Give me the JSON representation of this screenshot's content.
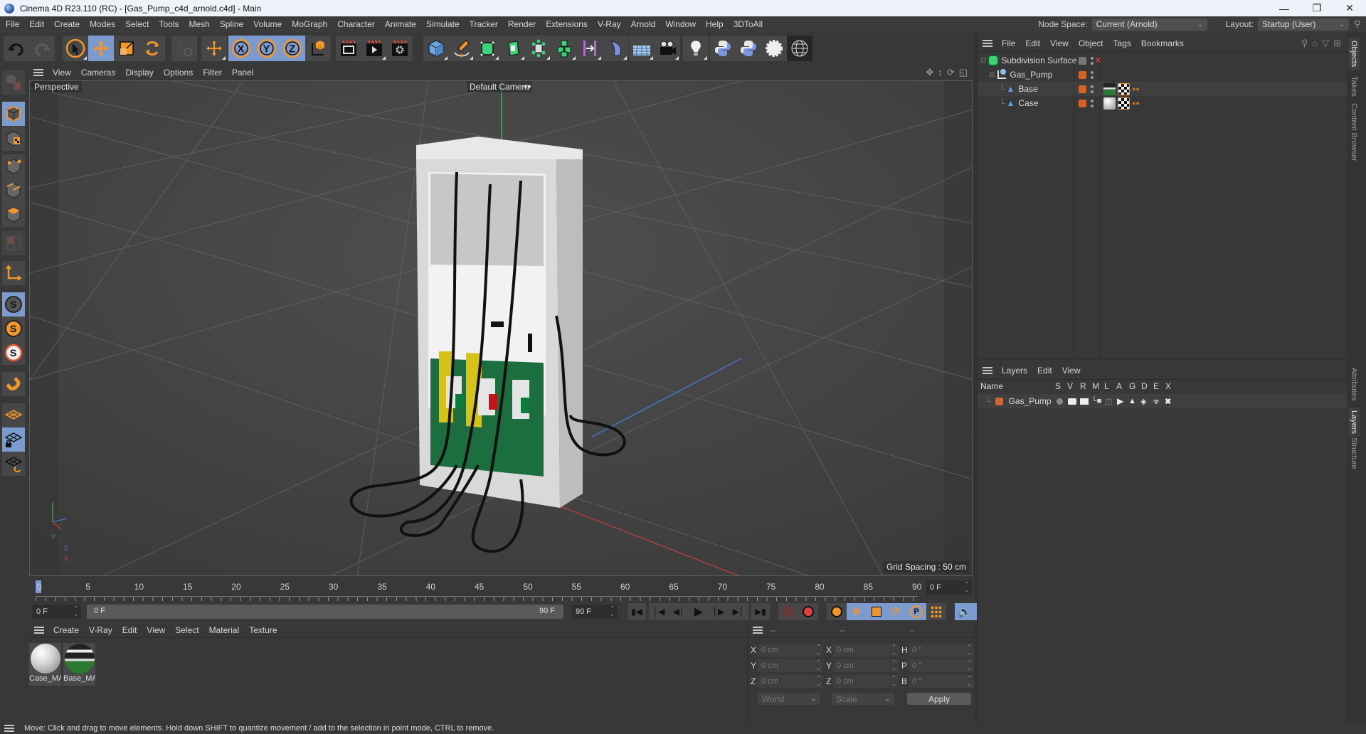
{
  "window": {
    "title": "Cinema 4D R23.110 (RC) - [Gas_Pump_c4d_arnold.c4d] - Main",
    "controls": [
      "minimize",
      "restore",
      "close"
    ]
  },
  "menubar": {
    "items": [
      "File",
      "Edit",
      "Create",
      "Modes",
      "Select",
      "Tools",
      "Mesh",
      "Spline",
      "Volume",
      "MoGraph",
      "Character",
      "Animate",
      "Simulate",
      "Tracker",
      "Render",
      "Extensions",
      "V-Ray",
      "Arnold",
      "Window",
      "Help",
      "3DToAll"
    ],
    "node_space_label": "Node Space:",
    "node_space_value": "Current (Arnold)",
    "layout_label": "Layout:",
    "layout_value": "Startup (User)"
  },
  "toolbar": {
    "groups": [
      [
        "undo-icon",
        "redo-icon"
      ],
      [
        "live-selection-icon",
        "move-icon",
        "scale-icon",
        "rotate-icon"
      ],
      [
        "psr-icon"
      ],
      [
        "world-axis-icon"
      ],
      [
        "x-axis-lock-icon",
        "y-axis-lock-icon",
        "z-axis-lock-icon",
        "coordinate-system-icon"
      ],
      [
        "render-view-icon",
        "render-picture-viewer-icon",
        "render-settings-icon"
      ],
      [
        "cube-icon",
        "pen-icon",
        "subdivision-icon",
        "extrude-icon",
        "mograph-cloner-icon",
        "voxel-icon",
        "symmetry-icon",
        "deformer-icon"
      ],
      [
        "floor-icon",
        "camera-icon"
      ],
      [
        "light-icon"
      ],
      [
        "python-icon",
        "python-script-icon",
        "gear-plugin-icon",
        "sphere-wireframe-icon"
      ]
    ]
  },
  "left_toolbar": {
    "items": [
      "make-editable-icon",
      "model-mode-icon",
      "texture-mode-icon",
      "points-mode-icon",
      "edges-mode-icon",
      "polygons-mode-icon",
      "uv-mode-icon",
      "axis-mode-icon",
      "snap-icon",
      "snap-settings-icon",
      "snap-enable-icon",
      "magnet-icon",
      "workplane-icon",
      "locked-workplane-icon",
      "workplane-align-icon"
    ]
  },
  "viewport": {
    "menu": [
      "View",
      "Cameras",
      "Display",
      "Options",
      "Filter",
      "Panel"
    ],
    "projection_label": "Perspective",
    "camera_label": "Default Camera",
    "grid_spacing": "Grid Spacing : 50 cm",
    "axis_labels": {
      "y": "Y",
      "z": "Z",
      "x": "X"
    }
  },
  "timeline": {
    "ticks": [
      "0",
      "5",
      "10",
      "15",
      "20",
      "25",
      "30",
      "35",
      "40",
      "45",
      "50",
      "55",
      "60",
      "65",
      "70",
      "75",
      "80",
      "85",
      "90"
    ],
    "current_frame": "0 F",
    "start_frame": "0 F",
    "range_start": "0 F",
    "range_end": "90 F",
    "end_frame": "90 F",
    "ruler_frame_field": "0 F"
  },
  "material_manager": {
    "menu": [
      "Create",
      "V-Ray",
      "Edit",
      "View",
      "Select",
      "Material",
      "Texture"
    ],
    "materials": [
      {
        "name": "Case_MA",
        "label": "Case_MA"
      },
      {
        "name": "Base_MA",
        "label": "Base_MA"
      }
    ]
  },
  "coordinates": {
    "headers": [
      "--",
      "--",
      "--"
    ],
    "position": [
      {
        "axis": "X",
        "value": "0 cm"
      },
      {
        "axis": "Y",
        "value": "0 cm"
      },
      {
        "axis": "Z",
        "value": "0 cm"
      }
    ],
    "size": [
      {
        "axis": "X",
        "value": "0 cm"
      },
      {
        "axis": "Y",
        "value": "0 cm"
      },
      {
        "axis": "Z",
        "value": "0 cm"
      }
    ],
    "rotation": [
      {
        "axis": "H",
        "value": "0 °"
      },
      {
        "axis": "P",
        "value": "0 °"
      },
      {
        "axis": "B",
        "value": "0 °"
      }
    ],
    "mode": "World",
    "transform": "Scale",
    "apply_label": "Apply"
  },
  "object_manager": {
    "menu": [
      "File",
      "Edit",
      "View",
      "Object",
      "Tags",
      "Bookmarks"
    ],
    "objects": [
      {
        "name": "Subdivision Surface",
        "level": 0,
        "icon": "subdivision-surface-icon"
      },
      {
        "name": "Gas_Pump",
        "level": 1,
        "icon": "null-object-icon"
      },
      {
        "name": "Base",
        "level": 2,
        "icon": "polygon-object-icon"
      },
      {
        "name": "Case",
        "level": 2,
        "icon": "polygon-object-icon"
      }
    ]
  },
  "layer_manager": {
    "menu": [
      "Layers",
      "Edit",
      "View"
    ],
    "columns": [
      "Name",
      "S",
      "V",
      "R",
      "M",
      "L",
      "A",
      "G",
      "D",
      "E",
      "X"
    ],
    "layers": [
      {
        "name": "Gas_Pump",
        "color": "#d2632a"
      }
    ]
  },
  "side_tabs": [
    "Objects",
    "Takes",
    "Content Browser",
    "Attributes",
    "Layers",
    "Structure"
  ],
  "status": {
    "message": "Move: Click and drag to move elements. Hold down SHIFT to quantize movement / add to the selection in point mode, CTRL to remove."
  },
  "colors": {
    "accent_orange": "#f0962a",
    "active_blue": "#7b9bcf",
    "layer_orange": "#d2632a",
    "panel_bg": "#383838"
  }
}
